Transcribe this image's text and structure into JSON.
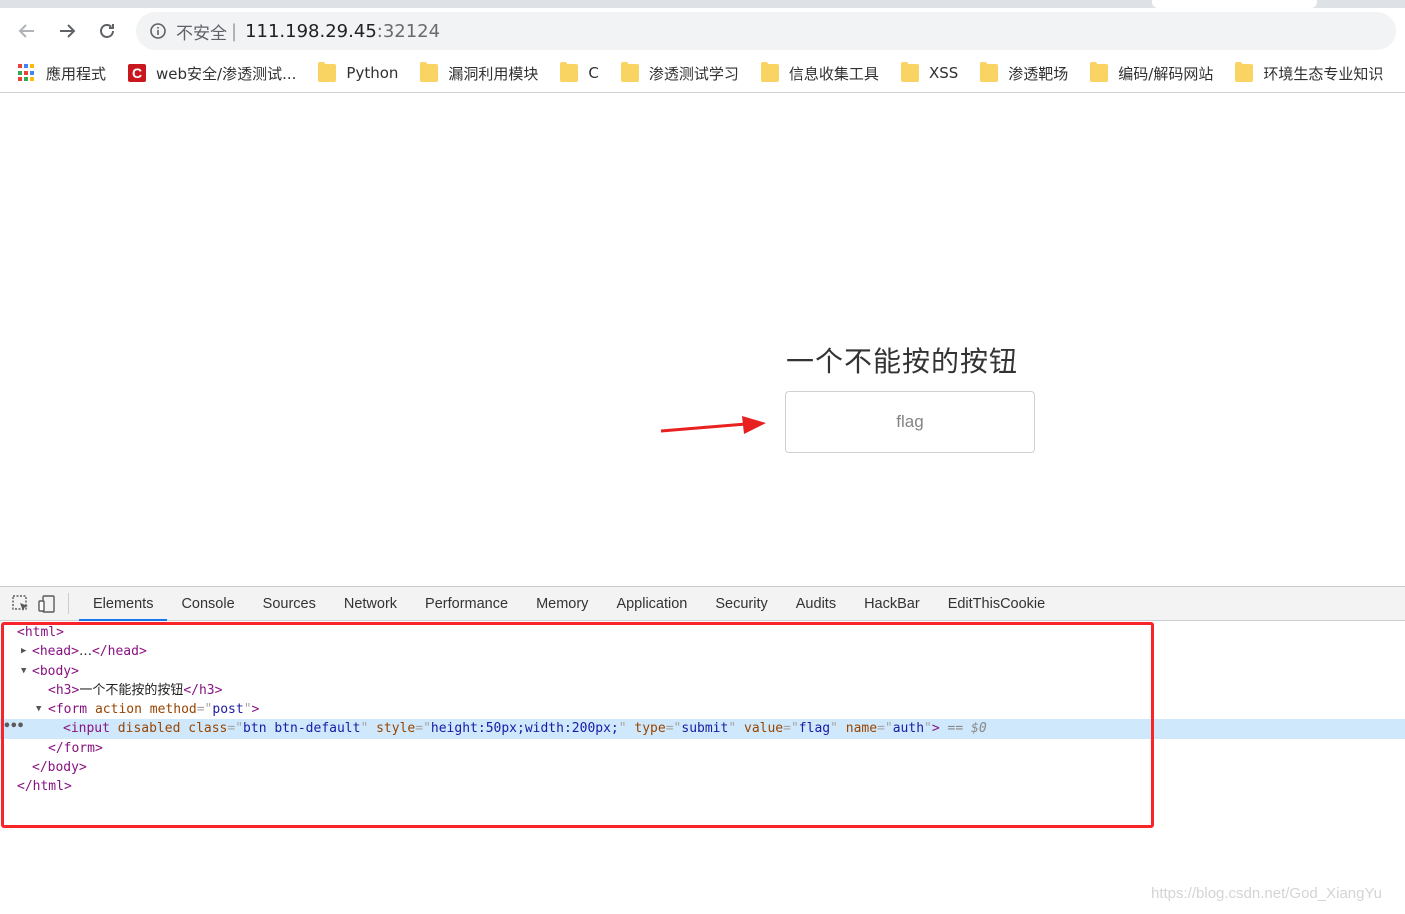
{
  "browser": {
    "address_bar": {
      "security_label": "不安全",
      "separator": "|",
      "host": "111.198.29.45",
      "port": ":32124"
    },
    "bookmarks": [
      {
        "label": "應用程式",
        "icon": "apps-grid-icon"
      },
      {
        "label": "web安全/渗透测试...",
        "icon": "csdn-icon"
      },
      {
        "label": "Python",
        "icon": "folder-icon"
      },
      {
        "label": "漏洞利用模块",
        "icon": "folder-icon"
      },
      {
        "label": "C",
        "icon": "folder-icon"
      },
      {
        "label": "渗透测试学习",
        "icon": "folder-icon"
      },
      {
        "label": "信息收集工具",
        "icon": "folder-icon"
      },
      {
        "label": "XSS",
        "icon": "folder-icon"
      },
      {
        "label": "渗透靶场",
        "icon": "folder-icon"
      },
      {
        "label": "编码/解码网站",
        "icon": "folder-icon"
      },
      {
        "label": "环境生态专业知识",
        "icon": "folder-icon"
      }
    ]
  },
  "page": {
    "heading": "一个不能按的按钮",
    "button_value": "flag",
    "annotation_arrow_color": "#e8201f"
  },
  "devtools": {
    "tabs": [
      "Elements",
      "Console",
      "Sources",
      "Network",
      "Performance",
      "Memory",
      "Application",
      "Security",
      "Audits",
      "HackBar",
      "EditThisCookie"
    ],
    "active_tab": "Elements",
    "dom": {
      "html_open": "html",
      "head_tag": "head",
      "head_ellipsis": "…",
      "body_tag": "body",
      "h3_tag": "h3",
      "h3_text": "一个不能按的按钮",
      "form_tag": "form",
      "form_attr_action": "action",
      "form_attr_method": "method",
      "form_method_value": "post",
      "input_tag": "input",
      "input_attr_disabled": "disabled",
      "input_attr_class": "class",
      "input_class_value": "btn btn-default",
      "input_attr_style": "style",
      "input_style_value": "height:50px;width:200px;",
      "input_attr_type": "type",
      "input_type_value": "submit",
      "input_attr_value": "value",
      "input_value_value": "flag",
      "input_attr_name": "name",
      "input_name_value": "auth",
      "selected_marker": "== $0"
    },
    "highlight_color": "#f8242a"
  },
  "watermark": "https://blog.csdn.net/God_XiangYu"
}
